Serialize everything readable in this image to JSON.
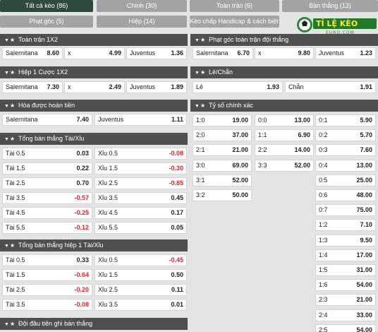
{
  "tabs": [
    {
      "label": "Tất cả kèo (86)",
      "active": true
    },
    {
      "label": "Chính (30)"
    },
    {
      "label": "Toàn trận (6)"
    },
    {
      "label": "Bàn thắng (13)"
    },
    {
      "label": "Phạt góc (5)"
    },
    {
      "label": "Hiệp (14)"
    },
    {
      "label": "Kèo chấp Handicap & cách biệt (5)"
    }
  ],
  "logo": {
    "title": "TỈ LỆ KÈO",
    "subtitle": "EURO.COM"
  },
  "markets": {
    "toan_tran_1x2": {
      "title": "Toàn trận 1X2",
      "home": "Salernitana",
      "home_odds": "8.60",
      "draw": "x",
      "draw_odds": "4.99",
      "away": "Juventus",
      "away_odds": "1.36"
    },
    "hiep1_1x2": {
      "title": "Hiệp 1 Cược 1X2",
      "home": "Salernitana",
      "home_odds": "7.30",
      "draw": "x",
      "draw_odds": "2.49",
      "away": "Juventus",
      "away_odds": "1.89"
    },
    "hoa_hoan_tien": {
      "title": "Hòa được hoàn tiền",
      "home": "Salernitana",
      "home_odds": "7.40",
      "away": "Juventus",
      "away_odds": "1.11"
    },
    "tong_ban_thang": {
      "title": "Tổng bàn thắng Tài/Xỉu",
      "rows": [
        {
          "over": "Tài 0.5",
          "over_odds": "0.03",
          "over_neg": false,
          "under": "Xỉu 0.5",
          "under_odds": "-0.08",
          "under_neg": true
        },
        {
          "over": "Tài 1.5",
          "over_odds": "0.22",
          "over_neg": false,
          "under": "Xỉu 1.5",
          "under_odds": "-0.30",
          "under_neg": true
        },
        {
          "over": "Tài 2.5",
          "over_odds": "0.70",
          "over_neg": false,
          "under": "Xỉu 2.5",
          "under_odds": "-0.85",
          "under_neg": true
        },
        {
          "over": "Tài 3.5",
          "over_odds": "-0.57",
          "over_neg": true,
          "under": "Xỉu 3.5",
          "under_odds": "0.45",
          "under_neg": false
        },
        {
          "over": "Tài 4.5",
          "over_odds": "-0.25",
          "over_neg": true,
          "under": "Xỉu 4.5",
          "under_odds": "0.17",
          "under_neg": false
        },
        {
          "over": "Tài 5.5",
          "over_odds": "-0.12",
          "over_neg": true,
          "under": "Xỉu 5.5",
          "under_odds": "0.05",
          "under_neg": false
        }
      ]
    },
    "tong_ban_thang_h1": {
      "title": "Tổng bàn thắng hiệp 1 Tài/Xỉu",
      "rows": [
        {
          "over": "Tài 0.5",
          "over_odds": "0.33",
          "over_neg": false,
          "under": "Xỉu 0.5",
          "under_odds": "-0.45",
          "under_neg": true
        },
        {
          "over": "Tài 1.5",
          "over_odds": "-0.64",
          "over_neg": true,
          "under": "Xỉu 1.5",
          "under_odds": "0.50",
          "under_neg": false
        },
        {
          "over": "Tài 2.5",
          "over_odds": "-0.20",
          "over_neg": true,
          "under": "Xỉu 2.5",
          "under_odds": "0.11",
          "under_neg": false
        },
        {
          "over": "Tài 3.5",
          "over_odds": "-0.08",
          "over_neg": true,
          "under": "Xỉu 3.5",
          "under_odds": "0.01",
          "under_neg": false
        }
      ]
    },
    "doi_dau_tien": {
      "title": "Đội đầu tiên ghi bàn thắng"
    },
    "phat_goc_1x2": {
      "title": "Phạt góc toàn trận đội thắng",
      "home": "Salernitana",
      "home_odds": "6.70",
      "draw": "x",
      "draw_odds": "9.80",
      "away": "Juventus",
      "away_odds": "1.23"
    },
    "le_chan": {
      "title": "Lẻ/Chẵn",
      "odd": "Lẻ",
      "odd_odds": "1.93",
      "even": "Chẵn",
      "even_odds": "1.91"
    },
    "ty_so": {
      "title": "Tỷ số chính xác",
      "col1": [
        {
          "score": "1:0",
          "odds": "19.00"
        },
        {
          "score": "2:0",
          "odds": "37.00"
        },
        {
          "score": "2:1",
          "odds": "21.00"
        },
        {
          "score": "3:0",
          "odds": "69.00"
        },
        {
          "score": "3:1",
          "odds": "52.00"
        },
        {
          "score": "3:2",
          "odds": "50.00"
        }
      ],
      "col2": [
        {
          "score": "0:0",
          "odds": "13.00"
        },
        {
          "score": "1:1",
          "odds": "6.90"
        },
        {
          "score": "2:2",
          "odds": "14.00"
        },
        {
          "score": "3:3",
          "odds": "52.00"
        }
      ],
      "col3": [
        {
          "score": "0:1",
          "odds": "5.90"
        },
        {
          "score": "0:2",
          "odds": "5.70"
        },
        {
          "score": "0:3",
          "odds": "7.60"
        },
        {
          "score": "0:4",
          "odds": "13.00"
        },
        {
          "score": "0:5",
          "odds": "25.00"
        },
        {
          "score": "0:6",
          "odds": "48.00"
        },
        {
          "score": "0:7",
          "odds": "75.00"
        },
        {
          "score": "1:2",
          "odds": "7.10"
        },
        {
          "score": "1:3",
          "odds": "9.50"
        },
        {
          "score": "1:4",
          "odds": "17.00"
        },
        {
          "score": "1:5",
          "odds": "31.00"
        },
        {
          "score": "1:6",
          "odds": "54.00"
        },
        {
          "score": "2:3",
          "odds": "21.00"
        },
        {
          "score": "2:4",
          "odds": "33.00"
        },
        {
          "score": "2:5",
          "odds": "54.00"
        }
      ]
    }
  }
}
